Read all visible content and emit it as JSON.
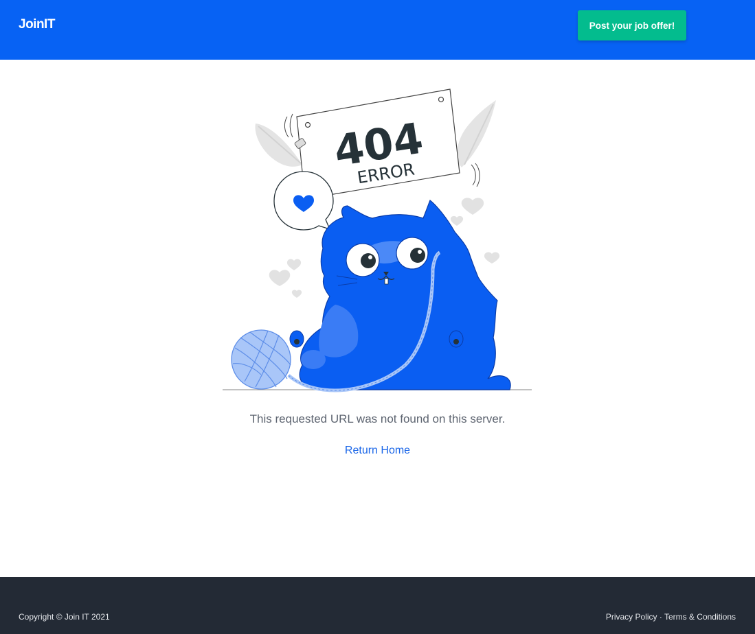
{
  "header": {
    "logo": "JoinIT",
    "post_button_label": "Post your job offer!"
  },
  "illustration": {
    "sign_code": "404",
    "sign_text": "ERROR"
  },
  "main": {
    "message": "This requested URL was not found on this server.",
    "return_link_label": "Return Home"
  },
  "footer": {
    "copyright": "Copyright © Join IT 2021",
    "privacy_label": "Privacy Policy",
    "separator": " · ",
    "terms_label": "Terms & Conditions"
  },
  "colors": {
    "header_bg": "#0762f4",
    "button_bg": "#03bc8e",
    "footer_bg": "#232a35",
    "link": "#1a66e8",
    "illustration_blue": "#0a5ef2"
  }
}
